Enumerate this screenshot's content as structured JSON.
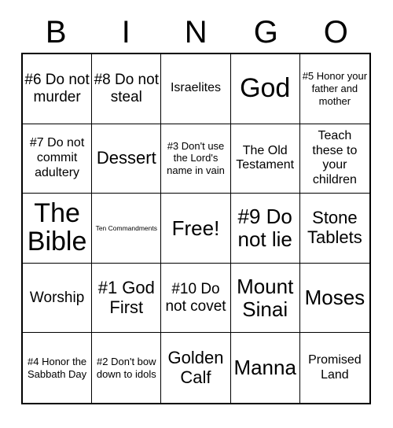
{
  "header": {
    "letters": [
      "B",
      "I",
      "N",
      "G",
      "O"
    ]
  },
  "grid": {
    "rows": 5,
    "columns": 5,
    "cells": [
      {
        "text": "#6 Do not murder",
        "size": "md"
      },
      {
        "text": "#8 Do not steal",
        "size": "md"
      },
      {
        "text": "Israelites",
        "size": "sm"
      },
      {
        "text": "God",
        "size": "xxl"
      },
      {
        "text": "#5 Honor your father and mother",
        "size": "xs"
      },
      {
        "text": "#7 Do not commit adultery",
        "size": "sm"
      },
      {
        "text": "Dessert",
        "size": "lg"
      },
      {
        "text": "#3 Don't use the Lord's name in vain",
        "size": "xs"
      },
      {
        "text": "The Old Testament",
        "size": "sm"
      },
      {
        "text": "Teach these to your children",
        "size": "sm"
      },
      {
        "text": "The Bible",
        "size": "xxl"
      },
      {
        "text": "Ten Commandments",
        "size": "xxs"
      },
      {
        "text": "Free!",
        "size": "xl"
      },
      {
        "text": "#9 Do not lie",
        "size": "xl"
      },
      {
        "text": "Stone Tablets",
        "size": "lg"
      },
      {
        "text": "Worship",
        "size": "md"
      },
      {
        "text": "#1 God First",
        "size": "lg"
      },
      {
        "text": "#10 Do not covet",
        "size": "md"
      },
      {
        "text": "Mount Sinai",
        "size": "xl"
      },
      {
        "text": "Moses",
        "size": "xl"
      },
      {
        "text": "#4 Honor the Sabbath Day",
        "size": "xs"
      },
      {
        "text": "#2 Don't bow down to idols",
        "size": "xs"
      },
      {
        "text": "Golden Calf",
        "size": "lg"
      },
      {
        "text": "Manna",
        "size": "xl"
      },
      {
        "text": "Promised Land",
        "size": "sm"
      }
    ]
  },
  "colors": {
    "background": "#ffffff",
    "text": "#000000",
    "border": "#000000"
  }
}
